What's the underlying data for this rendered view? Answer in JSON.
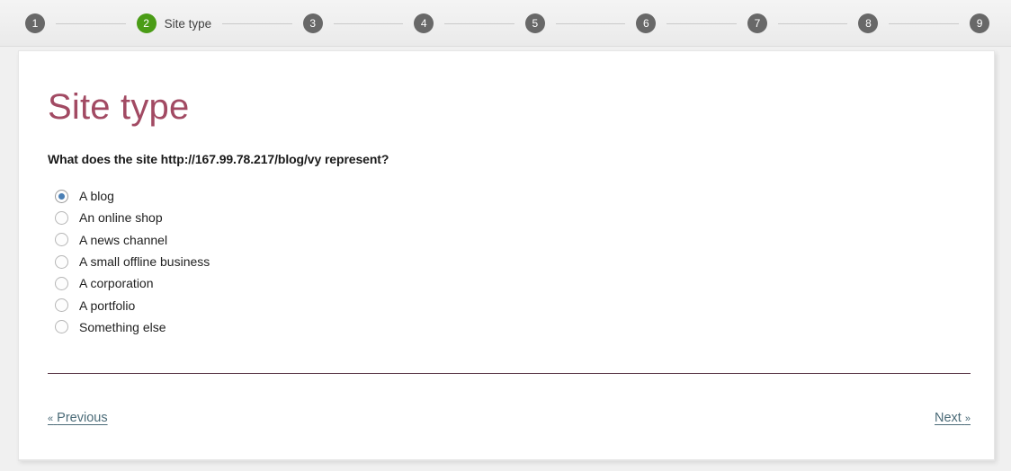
{
  "stepper": {
    "steps": [
      {
        "number": "1",
        "label": "",
        "state": "pending"
      },
      {
        "number": "2",
        "label": "Site type",
        "state": "current"
      },
      {
        "number": "3",
        "label": "",
        "state": "pending"
      },
      {
        "number": "4",
        "label": "",
        "state": "pending"
      },
      {
        "number": "5",
        "label": "",
        "state": "pending"
      },
      {
        "number": "6",
        "label": "",
        "state": "pending"
      },
      {
        "number": "7",
        "label": "",
        "state": "pending"
      },
      {
        "number": "8",
        "label": "",
        "state": "pending"
      },
      {
        "number": "9",
        "label": "",
        "state": "pending"
      }
    ],
    "current_color": "#4a9c16",
    "pending_color": "#686868",
    "connector_color": "#c9c9c9"
  },
  "page": {
    "title": "Site type",
    "title_color": "#a24a63",
    "question": "What does the site http://167.99.78.217/blog/vy represent?",
    "divider_color": "#5c3a4a"
  },
  "options": {
    "selected_index": 0,
    "selected_dot_color": "#4a7fb5",
    "items": [
      {
        "label": "A blog",
        "selected": true
      },
      {
        "label": "An online shop",
        "selected": false
      },
      {
        "label": "A news channel",
        "selected": false
      },
      {
        "label": "A small offline business",
        "selected": false
      },
      {
        "label": "A corporation",
        "selected": false
      },
      {
        "label": "A portfolio",
        "selected": false
      },
      {
        "label": "Something else",
        "selected": false
      }
    ]
  },
  "footer": {
    "previous_chevron": "«",
    "previous_label": "Previous",
    "next_label": "Next",
    "next_chevron": "»",
    "link_color": "#4b6b78"
  }
}
